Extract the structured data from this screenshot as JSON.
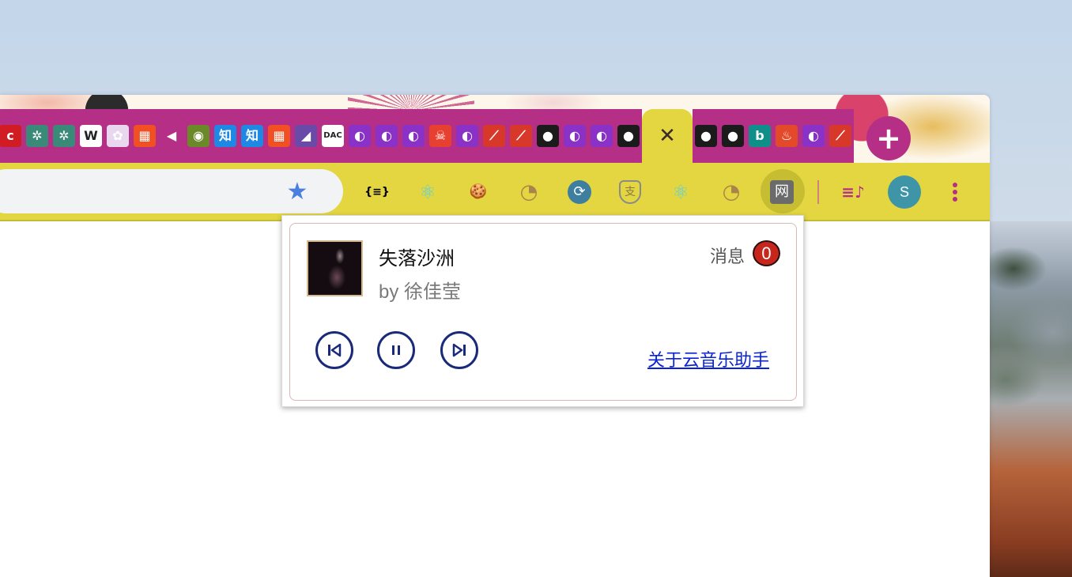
{
  "colors": {
    "tab_bg": "#b62f86",
    "active_tab_bg": "#e3d641",
    "toolbar_bg": "#e3d641",
    "control_stroke": "#1a2a7a",
    "badge_bg": "#c6261c",
    "link": "#0a22d6"
  },
  "tabs": [
    {
      "icon": "c-red-icon",
      "glyph": "c",
      "bg": "#d01c22"
    },
    {
      "icon": "green-gear-icon",
      "glyph": "✲",
      "bg": "#3a8a7a"
    },
    {
      "icon": "green-gear-icon",
      "glyph": "✲",
      "bg": "#3a8a7a"
    },
    {
      "icon": "wikipedia-icon",
      "glyph": "W",
      "bg": "#ffffff"
    },
    {
      "icon": "unicorn-icon",
      "glyph": "✿",
      "bg": "#e8d7ef"
    },
    {
      "icon": "microsoft-icon",
      "glyph": "▦",
      "bg": "#f25022"
    },
    {
      "icon": "speaker-icon",
      "glyph": "◀",
      "bg": "#b62f86"
    },
    {
      "icon": "burger-icon",
      "glyph": "◉",
      "bg": "#6a8a2a"
    },
    {
      "icon": "zhihu-icon",
      "glyph": "知",
      "bg": "#1e88e5"
    },
    {
      "icon": "zhihu-icon",
      "glyph": "知",
      "bg": "#1e88e5"
    },
    {
      "icon": "microsoft-icon",
      "glyph": "▦",
      "bg": "#f25022"
    },
    {
      "icon": "visual-studio-icon",
      "glyph": "◢",
      "bg": "#6a4aa8"
    },
    {
      "icon": "dac-icon",
      "glyph": "DAC",
      "bg": "#ffffff"
    },
    {
      "icon": "purple-swirl-icon",
      "glyph": "◐",
      "bg": "#8a32c8"
    },
    {
      "icon": "purple-swirl-icon",
      "glyph": "◐",
      "bg": "#8a32c8"
    },
    {
      "icon": "purple-swirl-icon",
      "glyph": "◐",
      "bg": "#8a32c8"
    },
    {
      "icon": "skull-icon",
      "glyph": "☠",
      "bg": "#e84030"
    },
    {
      "icon": "purple-swirl-icon",
      "glyph": "◐",
      "bg": "#8a32c8"
    },
    {
      "icon": "test-tube-icon",
      "glyph": "⟋",
      "bg": "#d8382a"
    },
    {
      "icon": "test-tube-icon",
      "glyph": "⟋",
      "bg": "#d8382a"
    },
    {
      "icon": "github-icon",
      "glyph": "●",
      "bg": "#1b1b1b"
    },
    {
      "icon": "purple-swirl-icon",
      "glyph": "◐",
      "bg": "#8a32c8"
    },
    {
      "icon": "purple-swirl-icon",
      "glyph": "◐",
      "bg": "#8a32c8"
    },
    {
      "icon": "github-icon",
      "glyph": "●",
      "bg": "#1b1b1b"
    }
  ],
  "active_tab": {
    "close_glyph": "✕"
  },
  "tabs_after": [
    {
      "icon": "github-icon",
      "glyph": "●",
      "bg": "#1b1b1b"
    },
    {
      "icon": "github-icon",
      "glyph": "●",
      "bg": "#1b1b1b"
    },
    {
      "icon": "bing-icon",
      "glyph": "b",
      "bg": "#0f8f8a"
    },
    {
      "icon": "flame-icon",
      "glyph": "♨",
      "bg": "#e24a2a"
    },
    {
      "icon": "purple-swirl-icon",
      "glyph": "◐",
      "bg": "#8a32c8"
    },
    {
      "icon": "test-tube-icon",
      "glyph": "⟋",
      "bg": "#d8382a"
    }
  ],
  "new_tab_glyph": "+",
  "toolbar": {
    "bookmark_glyph": "★",
    "extensions": [
      {
        "name": "json-viewer-extension-icon",
        "glyph": "{≡}"
      },
      {
        "name": "react-devtools-extension-icon",
        "glyph": "⚛"
      },
      {
        "name": "cookie-extension-icon",
        "glyph": "🍪"
      },
      {
        "name": "cookie-editor-extension-icon",
        "glyph": "◔"
      },
      {
        "name": "sync-extension-icon",
        "glyph": "⟳"
      },
      {
        "name": "alipay-shield-extension-icon",
        "glyph": "支"
      },
      {
        "name": "react-extension-icon",
        "glyph": "⚛"
      },
      {
        "name": "cookie-extension-icon-2",
        "glyph": "◔"
      },
      {
        "name": "netease-music-extension-icon",
        "glyph": "网"
      }
    ],
    "playlist_glyph": "≡♪",
    "avatar_letter": "S"
  },
  "popup": {
    "song_title": "失落沙洲",
    "song_artist": "by 徐佳莹",
    "messages_label": "消息",
    "messages_count": "0",
    "about_link": "关于云音乐助手"
  }
}
